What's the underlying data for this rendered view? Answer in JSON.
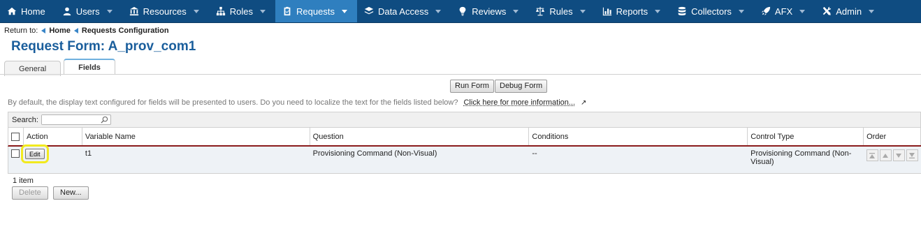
{
  "nav": {
    "items": [
      {
        "label": "Home",
        "icon": "home-icon"
      },
      {
        "label": "Users",
        "icon": "user-icon"
      },
      {
        "label": "Resources",
        "icon": "bank-icon"
      },
      {
        "label": "Roles",
        "icon": "org-chart-icon"
      },
      {
        "label": "Requests",
        "icon": "clipboard-icon",
        "active": true
      },
      {
        "label": "Data Access",
        "icon": "layers-icon"
      },
      {
        "label": "Reviews",
        "icon": "lightbulb-icon"
      },
      {
        "label": "Rules",
        "icon": "scales-icon"
      },
      {
        "label": "Reports",
        "icon": "bar-chart-icon"
      },
      {
        "label": "Collectors",
        "icon": "database-icon"
      },
      {
        "label": "AFX",
        "icon": "rocket-icon"
      },
      {
        "label": "Admin",
        "icon": "tools-icon"
      }
    ]
  },
  "breadcrumb": {
    "prefix": "Return to:",
    "items": [
      "Home",
      "Requests Configuration"
    ]
  },
  "page": {
    "title": "Request Form: A_prov_com1"
  },
  "tabs": [
    "General",
    "Fields"
  ],
  "toolbar": {
    "run_label": "Run Form",
    "debug_label": "Debug Form"
  },
  "info": {
    "text": "By default, the display text configured for fields will be presented to users. Do you need to localize the text for the fields listed below?",
    "link": "Click here for more information..."
  },
  "grid": {
    "search_label": "Search:",
    "search_value": "",
    "columns": [
      "Action",
      "Variable Name",
      "Question",
      "Conditions",
      "Control Type",
      "Order"
    ],
    "rows": [
      {
        "action": "Edit",
        "variable_name": "t1",
        "question": "Provisioning Command (Non-Visual)",
        "conditions": "--",
        "control_type": "Provisioning Command (Non-Visual)"
      }
    ],
    "count": "1 item",
    "delete_label": "Delete",
    "new_label": "New..."
  },
  "colors": {
    "nav_bg": "#0f4c81",
    "nav_active": "#2f7fbf",
    "title": "#1a5e9c",
    "highlight": "#f2ea1e",
    "header_border": "#8b1c1c"
  }
}
